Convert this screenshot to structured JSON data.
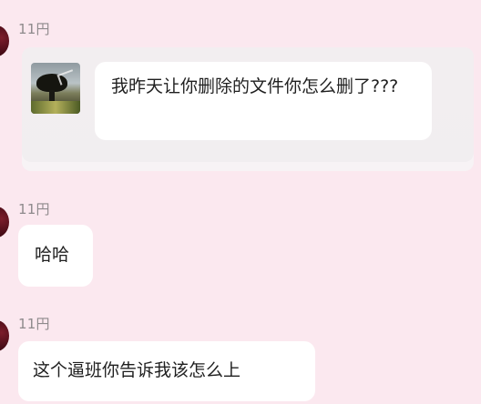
{
  "messages": [
    {
      "sender": "11円",
      "text": "我昨天让你删除的文件你怎么删了???"
    },
    {
      "sender": "11円",
      "text": "哈哈"
    },
    {
      "sender": "11円",
      "text": "这个逼班你告诉我该怎么上"
    }
  ],
  "colors": {
    "background": "#fbe8ef",
    "bubble": "#ffffff",
    "sender_text": "#8e8a8c"
  }
}
